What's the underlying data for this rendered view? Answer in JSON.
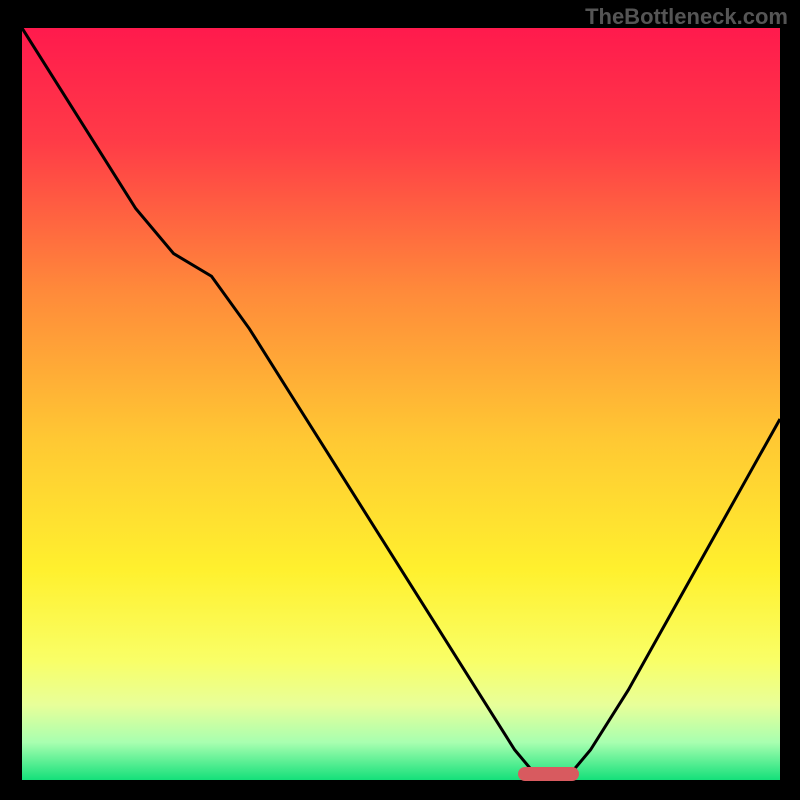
{
  "watermark": "TheBottleneck.com",
  "chart_data": {
    "type": "line",
    "title": "",
    "xlabel": "",
    "ylabel": "",
    "x": [
      0.0,
      0.05,
      0.1,
      0.15,
      0.2,
      0.25,
      0.3,
      0.35,
      0.4,
      0.45,
      0.5,
      0.55,
      0.6,
      0.65,
      0.675,
      0.7,
      0.725,
      0.75,
      0.8,
      0.85,
      0.9,
      0.95,
      1.0
    ],
    "y": [
      1.0,
      0.92,
      0.84,
      0.76,
      0.7,
      0.67,
      0.6,
      0.52,
      0.44,
      0.36,
      0.28,
      0.2,
      0.12,
      0.04,
      0.01,
      0.005,
      0.01,
      0.04,
      0.12,
      0.21,
      0.3,
      0.39,
      0.48
    ],
    "xlim": [
      0,
      1
    ],
    "ylim": [
      0,
      1
    ],
    "gradient_stops": [
      {
        "offset": 0.0,
        "color": "#ff1a4d"
      },
      {
        "offset": 0.15,
        "color": "#ff3b47"
      },
      {
        "offset": 0.35,
        "color": "#ff8a3a"
      },
      {
        "offset": 0.55,
        "color": "#ffc933"
      },
      {
        "offset": 0.72,
        "color": "#fff02e"
      },
      {
        "offset": 0.84,
        "color": "#f9ff66"
      },
      {
        "offset": 0.9,
        "color": "#e8ff99"
      },
      {
        "offset": 0.95,
        "color": "#a8ffb0"
      },
      {
        "offset": 1.0,
        "color": "#14e07a"
      }
    ],
    "marker": {
      "x0": 0.655,
      "x1": 0.735,
      "y": 0.008,
      "color": "#d85a5f"
    }
  }
}
